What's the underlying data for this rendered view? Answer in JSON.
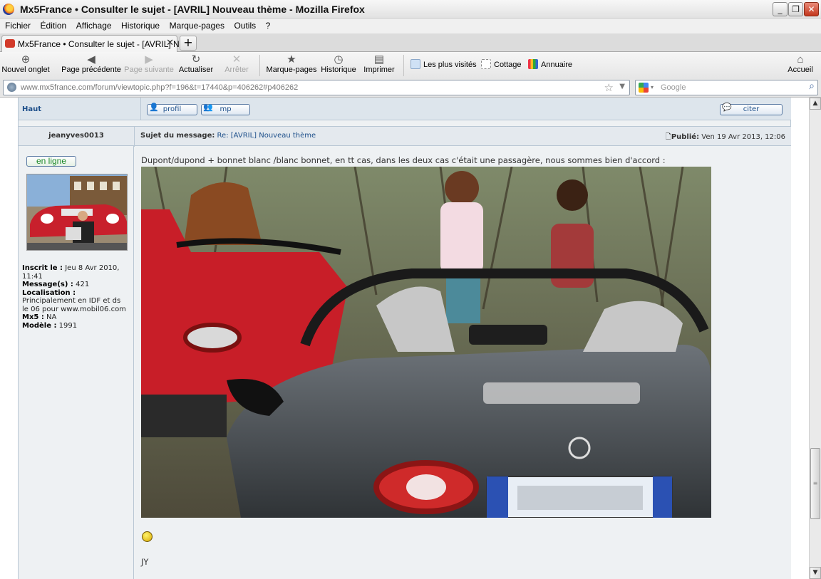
{
  "window": {
    "title": "Mx5France • Consulter le sujet - [AVRIL] Nouveau thème - Mozilla Firefox",
    "min_label": "_",
    "max_label": "❐",
    "close_label": "✕"
  },
  "menu": [
    "Fichier",
    "Édition",
    "Affichage",
    "Historique",
    "Marque-pages",
    "Outils",
    "?"
  ],
  "tabs": {
    "active_label": "Mx5France • Consulter le sujet - [AVRIL] No...",
    "close_label": "✕",
    "new_label": "+"
  },
  "toolbar": {
    "new_tab": "Nouvel onglet",
    "back": "Page précédente",
    "forward": "Page suivante",
    "reload": "Actualiser",
    "stop": "Arrêter",
    "bookmarks": "Marque-pages",
    "history": "Historique",
    "print": "Imprimer",
    "home": "Accueil",
    "bookmark_links": [
      "Les plus visités",
      "Cottage",
      "Annuaire"
    ]
  },
  "url": {
    "value": "www.mx5france.com/forum/viewtopic.php?f=196&t=17440&p=406262#p406262",
    "star": "☆",
    "drop": "▼"
  },
  "search": {
    "placeholder": "Google",
    "drop": "▾"
  },
  "forum": {
    "top_link": "Haut",
    "buttons": {
      "profil": "profil",
      "mp": "mp",
      "citer": "citer"
    },
    "post": {
      "author": "jeanyves0013",
      "subject_label": "Sujet du message:",
      "subject": "Re: [AVRIL] Nouveau thème",
      "published_label": "Publié:",
      "published": "Ven 19 Avr 2013, 12:06",
      "body": "Dupont/dupond + bonnet blanc /blanc bonnet, en tt cas, dans les deux cas c'était une passagère, nous sommes bien d'accord :",
      "signature": "JY",
      "smiley_icon": "smiley-icon"
    },
    "profile": {
      "online": "en ligne",
      "registered_label": "Inscrit le :",
      "registered": "Jeu 8 Avr 2010, 11:41",
      "messages_label": "Message(s) :",
      "messages": "421",
      "location_label": "Localisation :",
      "location": "Principalement en IDF et ds le 06 pour www.mobil06.com",
      "mx5_label": "Mx5 :",
      "mx5": "NA",
      "model_label": "Modèle :",
      "model": "1991"
    }
  },
  "colors": {
    "accent_blue": "#1d4f8a",
    "forum_bg": "#eef1f3",
    "online_green": "#1d8a2a"
  }
}
